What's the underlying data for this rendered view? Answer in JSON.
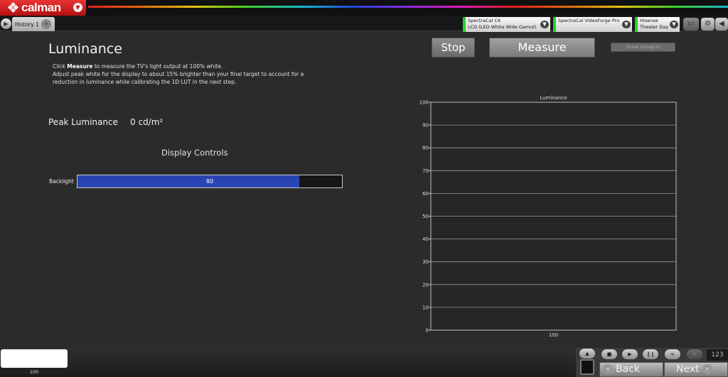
{
  "app": {
    "brand": "calman"
  },
  "tabs": {
    "history_label": "History 1",
    "add_label": "+"
  },
  "devices": [
    {
      "line1": "SpectraCal C6",
      "line2": "LCD (LED White Wide Gamut)"
    },
    {
      "line1": "SpectraCal VideoForge Pro",
      "line2": ""
    },
    {
      "line1": "Hisense",
      "line2": "Theater Day"
    }
  ],
  "page": {
    "title": "Luminance",
    "instructions": {
      "prefix": "Click ",
      "bold": "Measure",
      "suffix": " to measure the TV's light output at 100% white.",
      "line2": "Adjust peak white for the display to about 15% brighter than your final target to account for a",
      "line3": "reduction in luminance while calibrating the 1D LUT in the next step."
    }
  },
  "buttons": {
    "stop": "Stop",
    "measure": "Measure",
    "datagrid": "Show Datagrid"
  },
  "peak": {
    "label": "Peak Luminance",
    "value": "0 cd/m²"
  },
  "display_controls": {
    "title": "Display Controls",
    "backlight": {
      "label": "Backlight",
      "value": 80,
      "value_label": "80",
      "fraction": 0.84
    }
  },
  "chart_data": {
    "type": "bar",
    "title": "Luminance",
    "categories": [
      "100"
    ],
    "values": [
      0
    ],
    "ylim": [
      0,
      100
    ],
    "yticks": [
      0,
      10,
      20,
      30,
      40,
      50,
      60,
      70,
      80,
      90,
      100
    ],
    "grid": true
  },
  "bottom": {
    "swatch_label": "100",
    "back_label": "Back",
    "next_label": "Next",
    "counter": "123"
  },
  "colors": {
    "accent_red": "#d92020",
    "slider_fill": "#2945b3",
    "device_ok": "#2ad12a"
  }
}
